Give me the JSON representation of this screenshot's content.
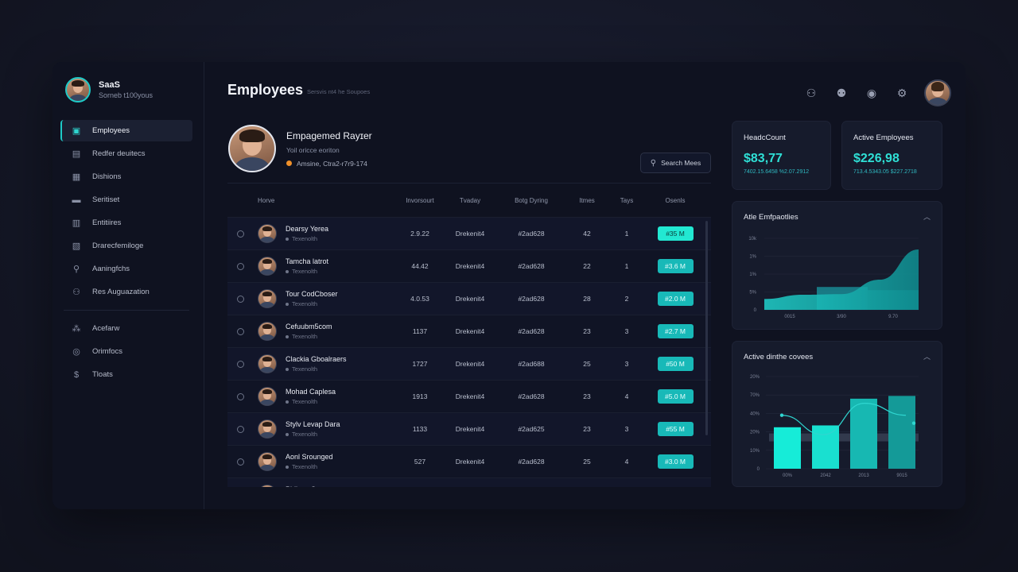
{
  "brand": {
    "title": "SaaS",
    "subtitle": "Sorneb t100yous"
  },
  "sidebar": {
    "items": [
      {
        "label": "Employees",
        "icon": "employees-icon",
        "active": true
      },
      {
        "label": "Redfer deuitecs",
        "icon": "document-icon"
      },
      {
        "label": "Dishions",
        "icon": "chat-icon"
      },
      {
        "label": "Seritiset",
        "icon": "card-icon"
      },
      {
        "label": "Entitiires",
        "icon": "grid-icon"
      },
      {
        "label": "Drarecfemiloge",
        "icon": "briefcase-icon"
      },
      {
        "label": "Aaningfchs",
        "icon": "location-icon"
      },
      {
        "label": "Res Auguazation",
        "icon": "people-icon"
      }
    ],
    "secondary": [
      {
        "label": "Acefarw",
        "icon": "team-icon"
      },
      {
        "label": "Orimfocs",
        "icon": "check-circle-icon"
      },
      {
        "label": "Tloats",
        "icon": "dollar-icon"
      }
    ]
  },
  "header": {
    "title": "Employees",
    "subtitle": "Sersvis nt4 he Soupoes"
  },
  "profile": {
    "name": "Empagemed Rayɪer",
    "role": "Yoil oricce eoriton",
    "meta": "Amsine, Ctra2-r7r9-174"
  },
  "search": {
    "label": "Search Mees"
  },
  "table": {
    "headers": [
      "Horve",
      "Invorsourt",
      "Tvaday",
      "Botg Dyring",
      "Itmes",
      "Tays",
      "Osenls"
    ],
    "rows": [
      {
        "name": "Dearsy Yerea",
        "sub": "Texenolth",
        "a": "2.9.22",
        "b": "Drekenit4",
        "c": "#2ad628",
        "d": "42",
        "e": "1",
        "f": "#35 M",
        "bright": true
      },
      {
        "name": "Tamcha latrot",
        "sub": "Texenolth",
        "a": "44.42",
        "b": "Drekenit4",
        "c": "#2ad628",
        "d": "22",
        "e": "1",
        "f": "#3.6 M",
        "bright": false
      },
      {
        "name": "Tour CodCboser",
        "sub": "Texenolth",
        "a": "4.0.53",
        "b": "Drekenit4",
        "c": "#2ad628",
        "d": "28",
        "e": "2",
        "f": "#2.0 M",
        "bright": false
      },
      {
        "name": "Cefuubm5com",
        "sub": "Texenolth",
        "a": "1137",
        "b": "Drekenit4",
        "c": "#2ad628",
        "d": "23",
        "e": "3",
        "f": "#2.7 M",
        "bright": false
      },
      {
        "name": "Clackia Gboalraers",
        "sub": "Texenolth",
        "a": "1727",
        "b": "Drekenit4",
        "c": "#2ad688",
        "d": "25",
        "e": "3",
        "f": "#50 M",
        "bright": false
      },
      {
        "name": "Mohad Caplesa",
        "sub": "Texenolth",
        "a": "1913",
        "b": "Drekenit4",
        "c": "#2ad628",
        "d": "23",
        "e": "4",
        "f": "#5.0 M",
        "bright": false
      },
      {
        "name": "Stylv Levap Dara",
        "sub": "Texenolth",
        "a": "1133",
        "b": "Drekenit4",
        "c": "#2ad625",
        "d": "23",
        "e": "3",
        "f": "#55 M",
        "bright": false
      },
      {
        "name": "Aonl Srounged",
        "sub": "Texenolth",
        "a": "527",
        "b": "Drekenit4",
        "c": "#2ad628",
        "d": "25",
        "e": "4",
        "f": "#3.0 M",
        "bright": false
      },
      {
        "name": "Phiisae Soonsonx",
        "sub": "Texenolth",
        "a": "",
        "b": "",
        "c": "",
        "d": "",
        "e": "",
        "f": "",
        "bright": false
      }
    ]
  },
  "kpis": [
    {
      "title": "HeadcCount",
      "value": "$83,77",
      "sub": "7402.15.6458 %2.07.2912"
    },
    {
      "title": "Active Employees",
      "value": "$226,98",
      "sub": "713.4.5343.05 $227.2718"
    }
  ],
  "chart_data": [
    {
      "type": "area",
      "title": "Atle Emfpaotlies",
      "x": [
        "0015",
        "3/90",
        "9.70"
      ],
      "y_ticks": [
        "10k",
        "1%",
        "1%",
        "5%",
        "0"
      ],
      "bar_height": 0.32,
      "area": [
        0.18,
        0.25,
        0.26,
        0.5,
        1.0
      ]
    },
    {
      "type": "bar",
      "title": "Active dinthe covees",
      "categories": [
        "00%",
        "2042",
        "2013",
        "9015"
      ],
      "y_ticks": [
        "20%",
        "70%",
        "40%",
        "20%",
        "10%",
        "0"
      ],
      "values": [
        0.45,
        0.47,
        0.76,
        0.79
      ],
      "line": [
        0.58,
        0.37,
        0.71,
        0.58
      ],
      "band_level": 0.34
    }
  ],
  "colors": {
    "accent": "#1ec9c7",
    "bright": "#22e8d2",
    "panel": "#161b2c",
    "bg": "#0f1220"
  }
}
